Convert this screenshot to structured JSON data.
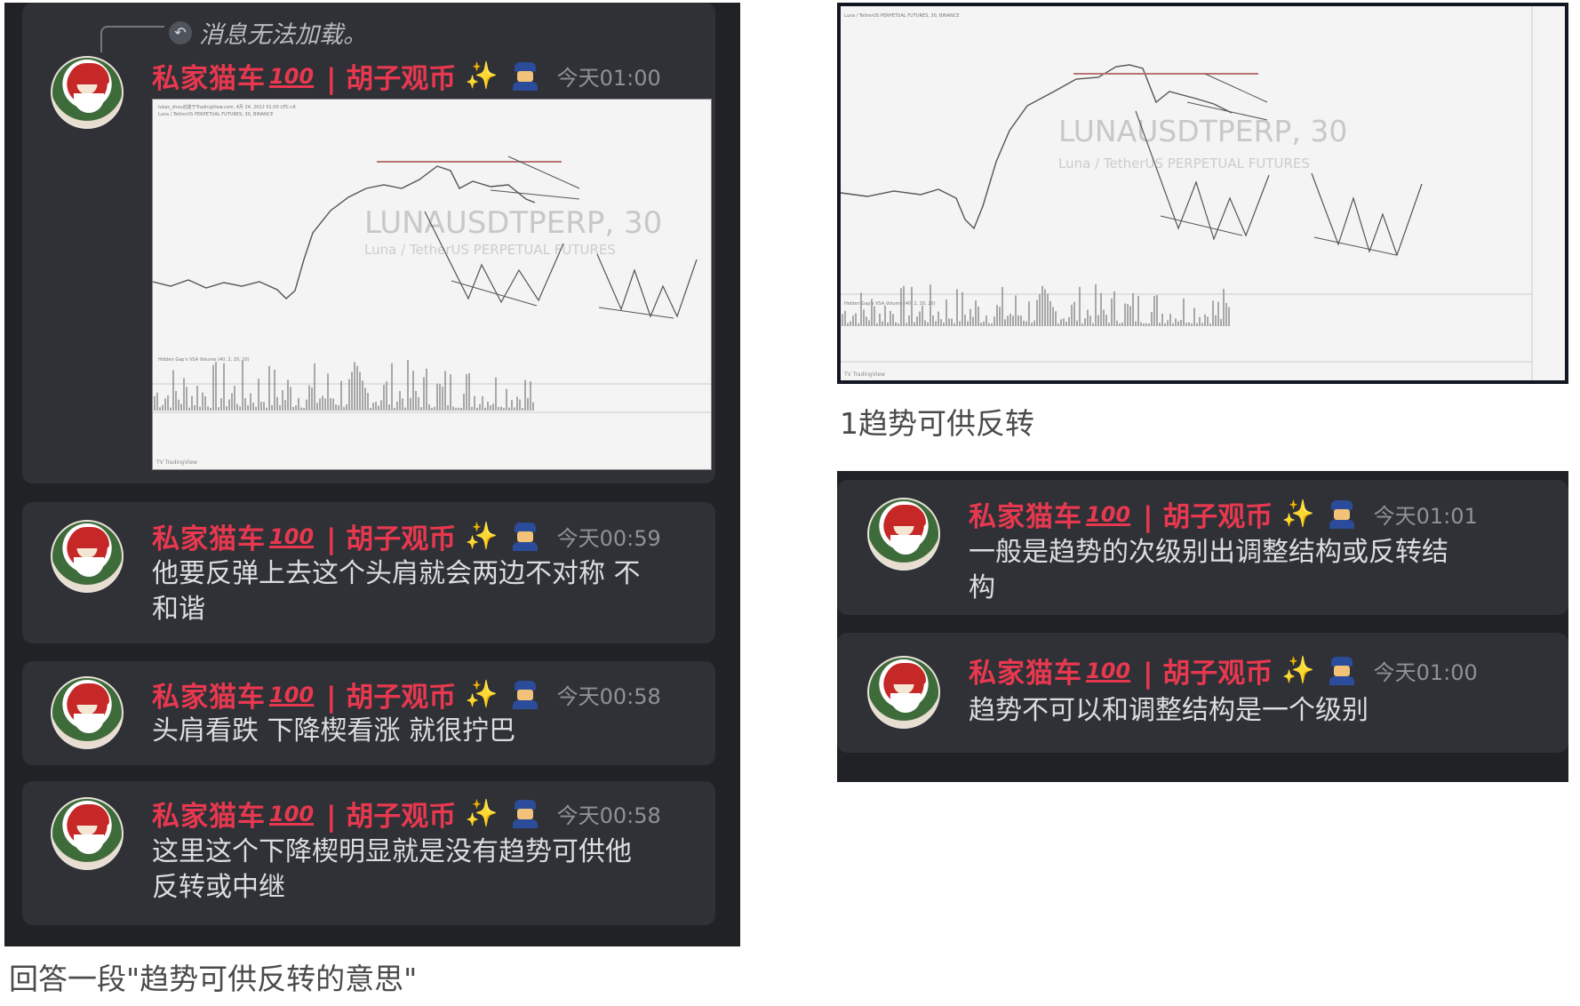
{
  "left": {
    "reply_text": "消息无法加载。",
    "messages": [
      {
        "username": "私家猫车",
        "badge": "💯",
        "nickname": "| 胡子观币",
        "time": "今天01:00",
        "text": "",
        "has_chart": true
      },
      {
        "username": "私家猫车",
        "badge": "💯",
        "nickname": "| 胡子观币",
        "time": "今天00:59",
        "text_line1": "他要反弹上去这个头肩就会两边不对称 不",
        "text_line2": "和谐"
      },
      {
        "username": "私家猫车",
        "badge": "💯",
        "nickname": "| 胡子观币",
        "time": "今天00:58",
        "text_line1": "头肩看跌 下降楔看涨 就很拧巴"
      },
      {
        "username": "私家猫车",
        "badge": "💯",
        "nickname": "| 胡子观币",
        "time": "今天00:58",
        "text_line1": "这里这个下降楔明显就是没有趋势可供他",
        "text_line2": "反转或中继"
      }
    ]
  },
  "chart": {
    "watermark_symbol": "LUNAUSDTPERP, 30",
    "watermark_sub": "Luna / TetherUS PERPETUAL FUTURES",
    "accent_colors": {
      "candle": "#444444",
      "line": "#6f6f6f",
      "resistance": "#c87f7f"
    }
  },
  "right": {
    "caption": "1趋势可供反转",
    "messages": [
      {
        "username": "私家猫车",
        "badge": "💯",
        "nickname": "| 胡子观币",
        "time": "今天01:01",
        "text_line1": "一般是趋势的次级别出调整结构或反转结",
        "text_line2": "构"
      },
      {
        "username": "私家猫车",
        "badge": "💯",
        "nickname": "| 胡子观币",
        "time": "今天01:00",
        "text_line1": "趋势不可以和调整结构是一个级别"
      }
    ]
  },
  "bottom_caption": "回答一段\"趋势可供反转的意思\"",
  "colors": {
    "discord_bg": "#202225",
    "card_bg": "#2f3136",
    "username": "#e8384f",
    "text": "#dcddde",
    "time": "#8e9297"
  }
}
